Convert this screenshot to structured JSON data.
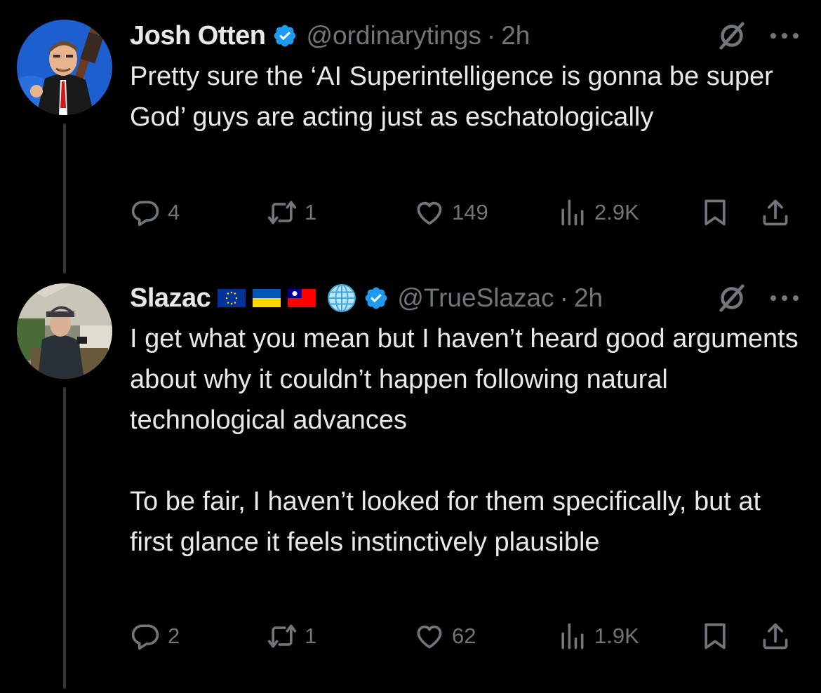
{
  "colors": {
    "background": "#000000",
    "text": "#e7e9ea",
    "secondary": "#71767b",
    "verified": "#1d9bf0",
    "thread_line": "#333639"
  },
  "tweets": [
    {
      "author": {
        "name": "Josh Otten",
        "handle": "@ordinarytings",
        "verified": true,
        "flags": []
      },
      "separator": "·",
      "time": "2h",
      "text": "Pretty sure the ‘AI Superintelligence is gonna be super God’ guys are acting just as eschatologically",
      "metrics": {
        "replies": "4",
        "retweets": "1",
        "likes": "149",
        "views": "2.9K"
      }
    },
    {
      "author": {
        "name": "Slazac",
        "handle": "@TrueSlazac",
        "verified": true,
        "flags": [
          "eu-flag-icon",
          "ukraine-flag-icon",
          "taiwan-flag-icon",
          "globe-icon"
        ]
      },
      "separator": "·",
      "time": "2h",
      "text": "I get what you mean but I haven’t heard good arguments about why it couldn’t happen following natural technological advances\n\nTo be fair, I haven’t looked for them specifically, but at first glance it feels instinctively plausible",
      "metrics": {
        "replies": "2",
        "retweets": "1",
        "likes": "62",
        "views": "1.9K"
      }
    }
  ]
}
